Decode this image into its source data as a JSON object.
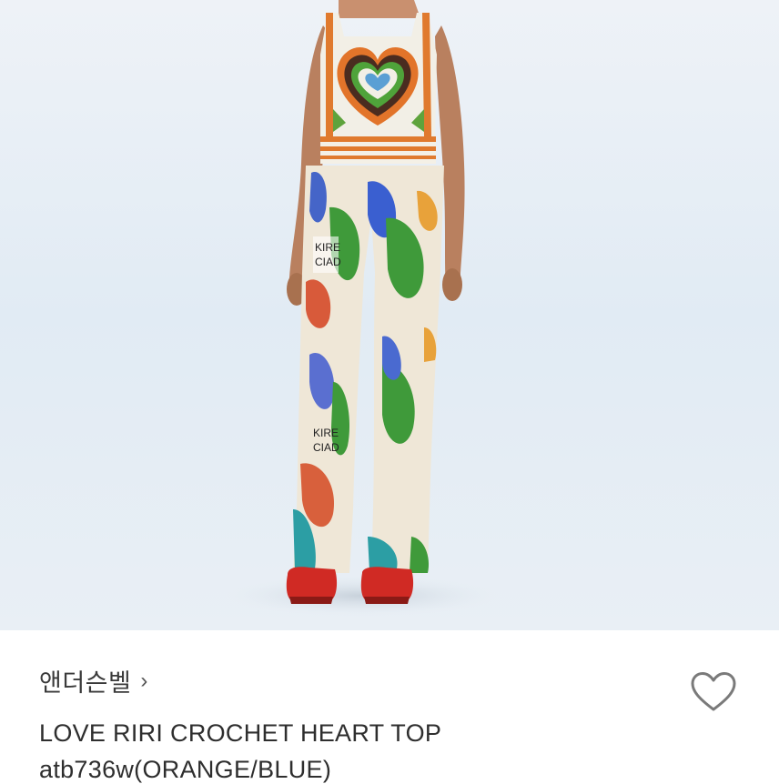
{
  "product": {
    "brand_name": "앤더슨벨",
    "brand_chevron": "›",
    "title_line_1": "LOVE RIRI CROCHET HEART TOP",
    "title_line_2": "atb736w(ORANGE/BLUE)"
  },
  "photo": {
    "alt": "Model wearing crochet heart top and painted flared pants"
  },
  "icons": {
    "like": "heart-outline-icon",
    "brand_link": "chevron-right-icon"
  },
  "colors": {
    "photo_background": "#e6eef6",
    "text_primary": "#2e2e2e",
    "icon_gray": "#7a7a7a"
  }
}
